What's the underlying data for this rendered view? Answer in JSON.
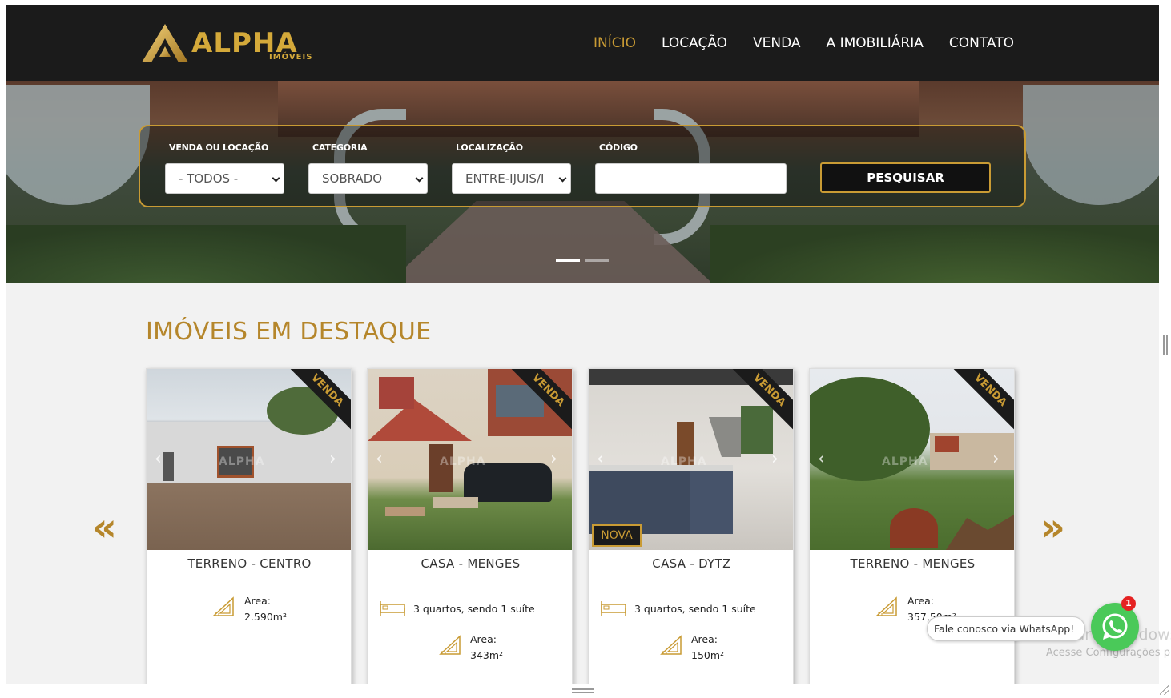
{
  "brand": {
    "name": "ALPHA",
    "sub": "IMÓVEIS",
    "gold": "#c99b34",
    "dark": "#1b1b1b"
  },
  "nav": {
    "items": [
      "INÍCIO",
      "LOCAÇÃO",
      "VENDA",
      "A IMOBILIÁRIA",
      "CONTATO"
    ],
    "active": "INÍCIO"
  },
  "search": {
    "type_label": "VENDA OU LOCAÇÃO",
    "type_value": "- TODOS -",
    "category_label": "CATEGORIA",
    "category_value": "SOBRADO",
    "location_label": "LOCALIZAÇÃO",
    "location_value": "ENTRE-IJUIS/I",
    "code_label": "CÓDIGO",
    "code_value": "",
    "button": "PESQUISAR"
  },
  "slider": {
    "slides": 2,
    "active": 1
  },
  "featured": {
    "title": "IMÓVEIS EM DESTAQUE",
    "prev": "«",
    "next": "»",
    "cards": [
      {
        "title": "TERRENO - CENTRO",
        "ribbon": "VENDA",
        "area_label": "Area:",
        "area": "2.590m²"
      },
      {
        "title": "CASA - MENGES",
        "ribbon": "VENDA",
        "rooms": "3 quartos, sendo 1 suíte",
        "area_label": "Area:",
        "area": "343m²"
      },
      {
        "title": "CASA - DYTZ",
        "ribbon": "VENDA",
        "badge": "NOVA",
        "rooms": "3 quartos, sendo 1 suíte",
        "area_label": "Area:",
        "area": "150m²"
      },
      {
        "title": "TERRENO - MENGES",
        "ribbon": "VENDA",
        "area_label": "Area:",
        "area": "357,50m²"
      }
    ]
  },
  "whatsapp": {
    "text": "Fale conosco via WhatsApp!",
    "count": "1",
    "icon": "whatsapp-icon"
  },
  "watermark": {
    "line1": "Ativar o Windows",
    "line2": "Acesse Configurações p"
  }
}
